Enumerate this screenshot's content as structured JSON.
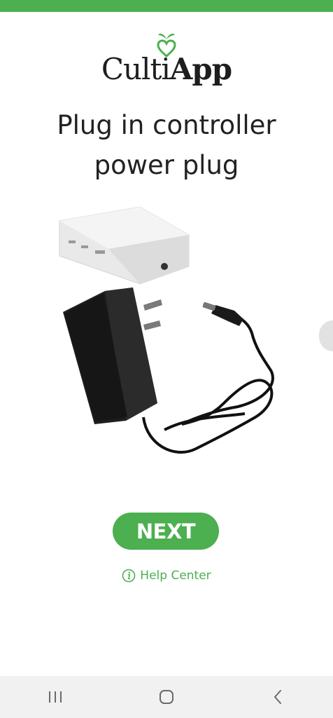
{
  "colors": {
    "accent": "#4caf50",
    "text": "#222222",
    "nav_bg": "#f1f1f1"
  },
  "logo": {
    "part1": "Culti",
    "part2": "App"
  },
  "headline": {
    "line1": "Plug in controller",
    "line2": "power plug"
  },
  "actions": {
    "next_label": "NEXT",
    "help_label": "Help Center"
  },
  "icons": {
    "logo": "heart-sprout-icon",
    "help": "info-circle-icon",
    "nav_recents": "recents-icon",
    "nav_home": "home-icon",
    "nav_back": "back-icon"
  }
}
